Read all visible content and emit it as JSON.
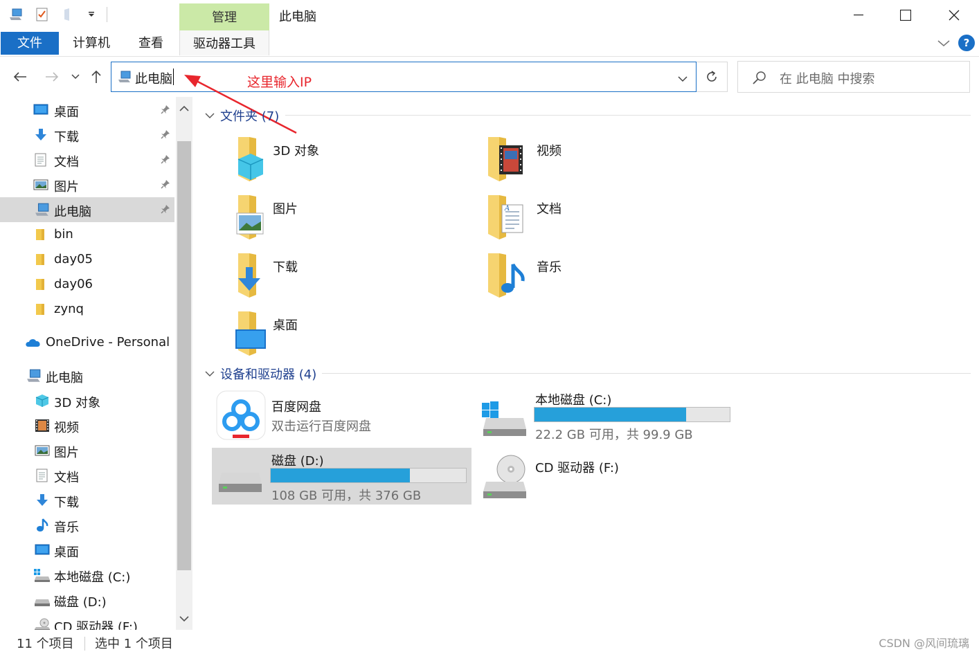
{
  "window": {
    "title": "此电脑",
    "context_tab": "管理",
    "controls": [
      "minimize",
      "maximize",
      "close"
    ]
  },
  "ribbon": {
    "tabs": [
      "文件",
      "计算机",
      "查看"
    ],
    "context_sub": "驱动器工具"
  },
  "address": {
    "path": "此电脑",
    "search_placeholder": "在 此电脑 中搜索"
  },
  "annotation": {
    "text": "这里输入IP",
    "color": "#e8262d"
  },
  "sidebar": {
    "quick_access": [
      {
        "label": "桌面",
        "icon": "desktop-icon",
        "pinned": true
      },
      {
        "label": "下载",
        "icon": "download-icon",
        "pinned": true
      },
      {
        "label": "文档",
        "icon": "document-icon",
        "pinned": true
      },
      {
        "label": "图片",
        "icon": "picture-icon",
        "pinned": true
      },
      {
        "label": "此电脑",
        "icon": "pc-icon",
        "pinned": true,
        "selected": true
      },
      {
        "label": "bin",
        "icon": "folder-icon"
      },
      {
        "label": "day05",
        "icon": "folder-icon"
      },
      {
        "label": "day06",
        "icon": "folder-icon"
      },
      {
        "label": "zynq",
        "icon": "folder-icon"
      }
    ],
    "onedrive": "OneDrive - Personal",
    "this_pc": "此电脑",
    "pc_items": [
      {
        "label": "3D 对象",
        "icon": "cube-icon"
      },
      {
        "label": "视频",
        "icon": "video-icon"
      },
      {
        "label": "图片",
        "icon": "picture-icon"
      },
      {
        "label": "文档",
        "icon": "document-icon"
      },
      {
        "label": "下载",
        "icon": "download-icon"
      },
      {
        "label": "音乐",
        "icon": "music-icon"
      },
      {
        "label": "桌面",
        "icon": "desktop-icon"
      },
      {
        "label": "本地磁盘 (C:)",
        "icon": "windows-drive-icon"
      },
      {
        "label": "磁盘 (D:)",
        "icon": "drive-icon"
      },
      {
        "label": "CD 驱动器 (F:)",
        "icon": "cd-drive-icon"
      }
    ]
  },
  "main": {
    "folders_header": "文件夹 (7)",
    "folders": [
      {
        "label": "3D 对象",
        "overlay": "cube"
      },
      {
        "label": "视频",
        "overlay": "film"
      },
      {
        "label": "图片",
        "overlay": "picture"
      },
      {
        "label": "文档",
        "overlay": "document"
      },
      {
        "label": "下载",
        "overlay": "arrow"
      },
      {
        "label": "音乐",
        "overlay": "note"
      },
      {
        "label": "桌面",
        "overlay": "screen"
      }
    ],
    "devices_header": "设备和驱动器 (4)",
    "devices": {
      "baidu": {
        "name": "百度网盘",
        "sub": "双击运行百度网盘"
      },
      "c": {
        "name": "本地磁盘 (C:)",
        "sub": "22.2 GB 可用，共 99.9 GB",
        "used_fraction": 0.778
      },
      "d": {
        "name": "磁盘 (D:)",
        "sub": "108 GB 可用，共 376 GB",
        "used_fraction": 0.713
      },
      "f": {
        "name": "CD 驱动器 (F:)"
      }
    }
  },
  "status": {
    "count": "11 个项目",
    "selected": "选中 1 个项目",
    "watermark": "CSDN @风间琉璃"
  }
}
